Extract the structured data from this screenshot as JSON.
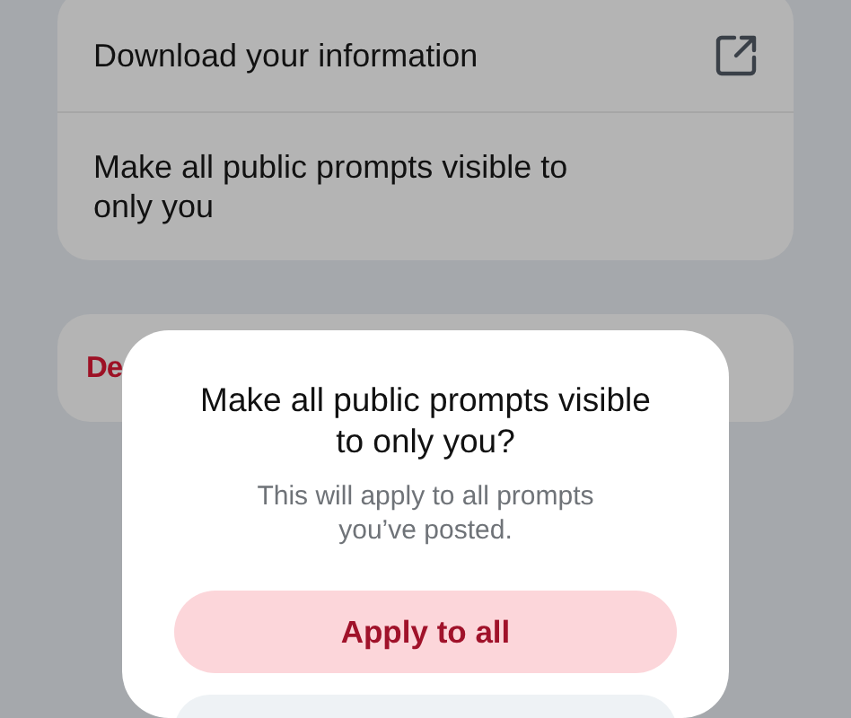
{
  "settings": [
    {
      "label": "Download your information",
      "kind": "link"
    },
    {
      "label": "Make all public prompts visible to only you",
      "kind": "plain"
    }
  ],
  "danger_row": {
    "label": "De"
  },
  "dialog": {
    "title": "Make all public prompts visible to only you?",
    "message": "This will apply to all prompts you’ve posted.",
    "primary_button": "Apply to all"
  }
}
